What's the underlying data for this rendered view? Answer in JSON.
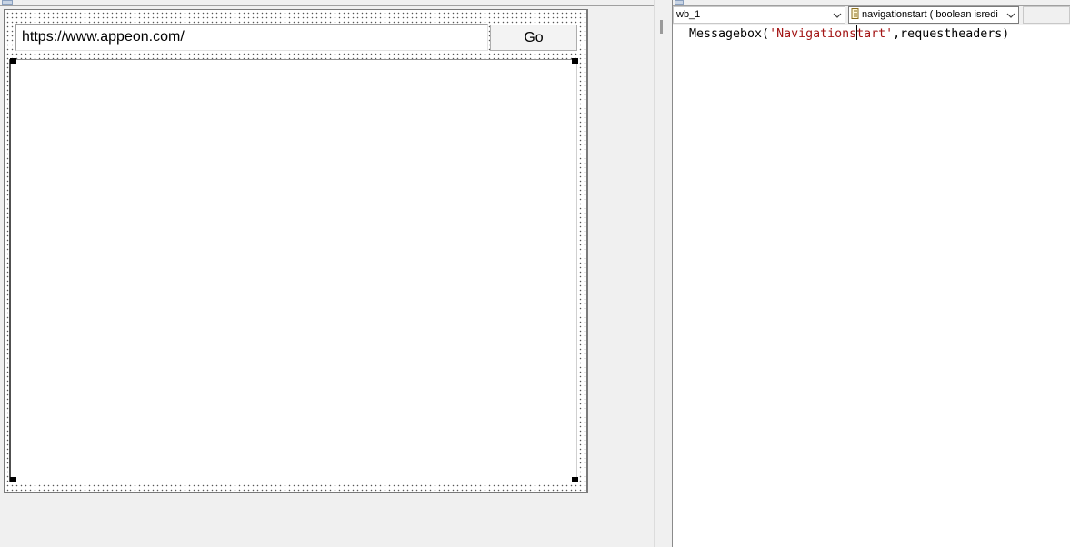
{
  "designer": {
    "url_value": "https://www.appeon.com/",
    "go_label": "Go"
  },
  "script_editor": {
    "object_select": "wb_1",
    "event_select": "navigationstart ( boolean isredi",
    "code": {
      "func": "Messagebox(",
      "str_part1": "'Navigations",
      "str_part2": "tart'",
      "rest": ",requestheaders)"
    }
  }
}
